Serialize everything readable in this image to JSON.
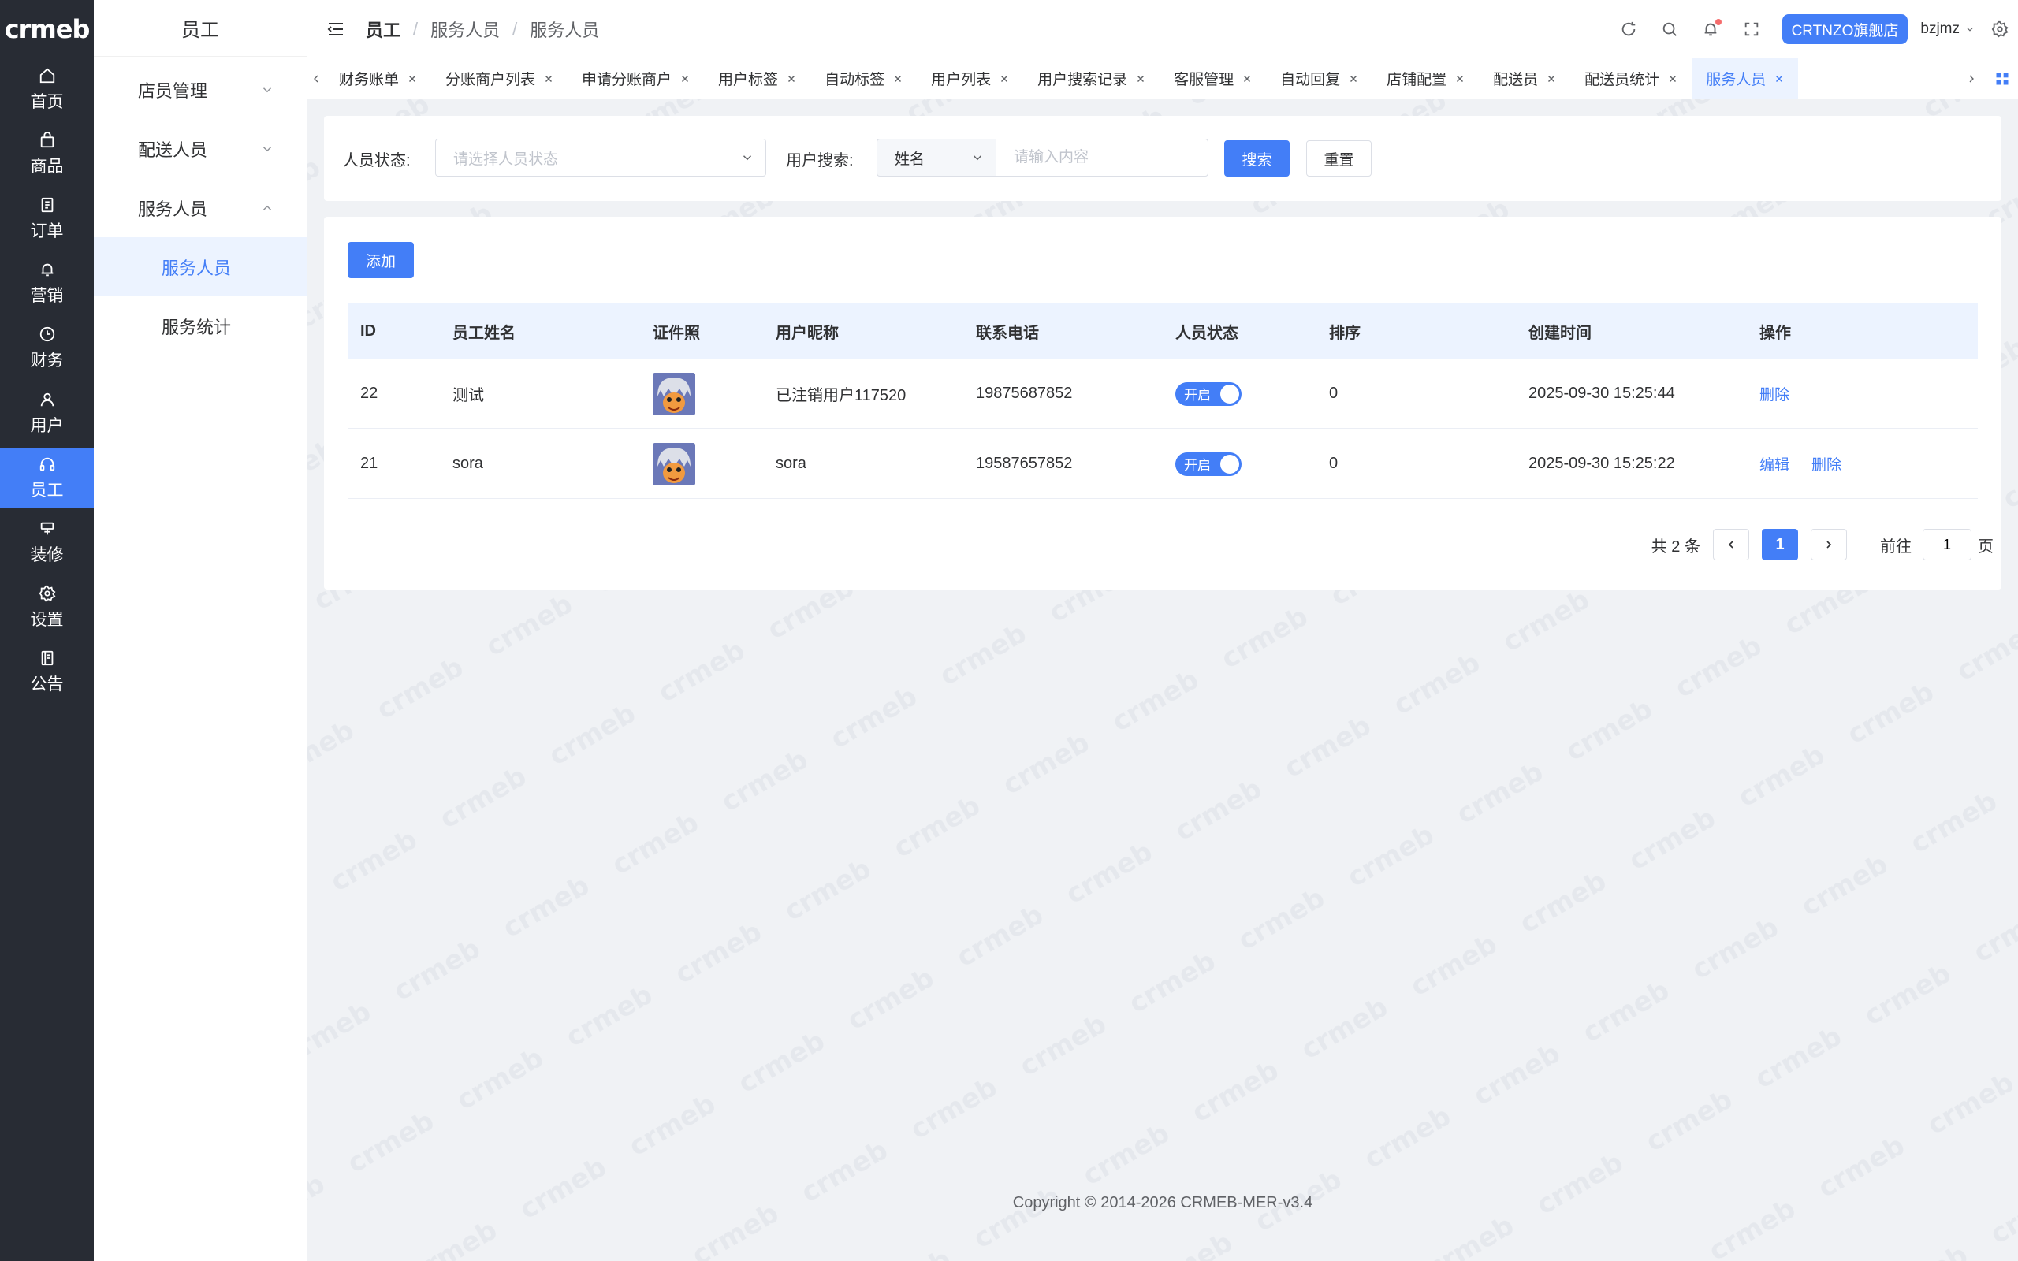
{
  "brand": {
    "logo_text": "crmeb",
    "accent": "#437ef7",
    "rail_bg": "#282c34"
  },
  "rail": [
    {
      "label": "首页",
      "icon": "home-icon"
    },
    {
      "label": "商品",
      "icon": "bag-icon"
    },
    {
      "label": "订单",
      "icon": "order-icon"
    },
    {
      "label": "营销",
      "icon": "bell-icon"
    },
    {
      "label": "财务",
      "icon": "clock-icon"
    },
    {
      "label": "用户",
      "icon": "user-icon"
    },
    {
      "label": "员工",
      "icon": "headset-icon",
      "active": true
    },
    {
      "label": "装修",
      "icon": "paint-icon"
    },
    {
      "label": "设置",
      "icon": "gear-icon"
    },
    {
      "label": "公告",
      "icon": "book-icon"
    }
  ],
  "subnav": {
    "title": "员工",
    "groups": [
      {
        "label": "店员管理",
        "expanded": false
      },
      {
        "label": "配送人员",
        "expanded": false
      },
      {
        "label": "服务人员",
        "expanded": true
      }
    ],
    "subitems": [
      {
        "label": "服务人员",
        "active": true
      },
      {
        "label": "服务统计",
        "active": false
      }
    ]
  },
  "header": {
    "breadcrumb": [
      "员工",
      "服务人员",
      "服务人员"
    ],
    "store_button": "CRTNZO旗舰店",
    "username": "bzjmz"
  },
  "tabs": [
    {
      "label": "财务账单"
    },
    {
      "label": "分账商户列表"
    },
    {
      "label": "申请分账商户"
    },
    {
      "label": "用户标签"
    },
    {
      "label": "自动标签"
    },
    {
      "label": "用户列表"
    },
    {
      "label": "用户搜索记录"
    },
    {
      "label": "客服管理"
    },
    {
      "label": "自动回复"
    },
    {
      "label": "店铺配置"
    },
    {
      "label": "配送员"
    },
    {
      "label": "配送员统计"
    },
    {
      "label": "服务人员",
      "active": true
    }
  ],
  "filter": {
    "status_label": "人员状态:",
    "status_placeholder": "请选择人员状态",
    "search_label": "用户搜索:",
    "search_type": "姓名",
    "search_placeholder": "请输入内容",
    "search_button": "搜索",
    "reset_button": "重置"
  },
  "table": {
    "add_button": "添加",
    "columns": [
      "ID",
      "员工姓名",
      "证件照",
      "用户昵称",
      "联系电话",
      "人员状态",
      "排序",
      "创建时间",
      "操作"
    ],
    "rows": [
      {
        "id": "22",
        "name": "测试",
        "nickname": "已注销用户117520",
        "phone": "19875687852",
        "status": "开启",
        "sort": "0",
        "created": "2025-09-30 15:25:44",
        "actions": [
          "删除"
        ]
      },
      {
        "id": "21",
        "name": "sora",
        "nickname": "sora",
        "phone": "19587657852",
        "status": "开启",
        "sort": "0",
        "created": "2025-09-30 15:25:22",
        "actions": [
          "编辑",
          "删除"
        ]
      }
    ]
  },
  "pagination": {
    "total_text": "共 2 条",
    "current_page": "1",
    "goto_label": "前往",
    "goto_value": "1",
    "page_suffix": "页"
  },
  "footer": {
    "copyright": "Copyright © 2014-2026 CRMEB-MER-v3.4"
  }
}
